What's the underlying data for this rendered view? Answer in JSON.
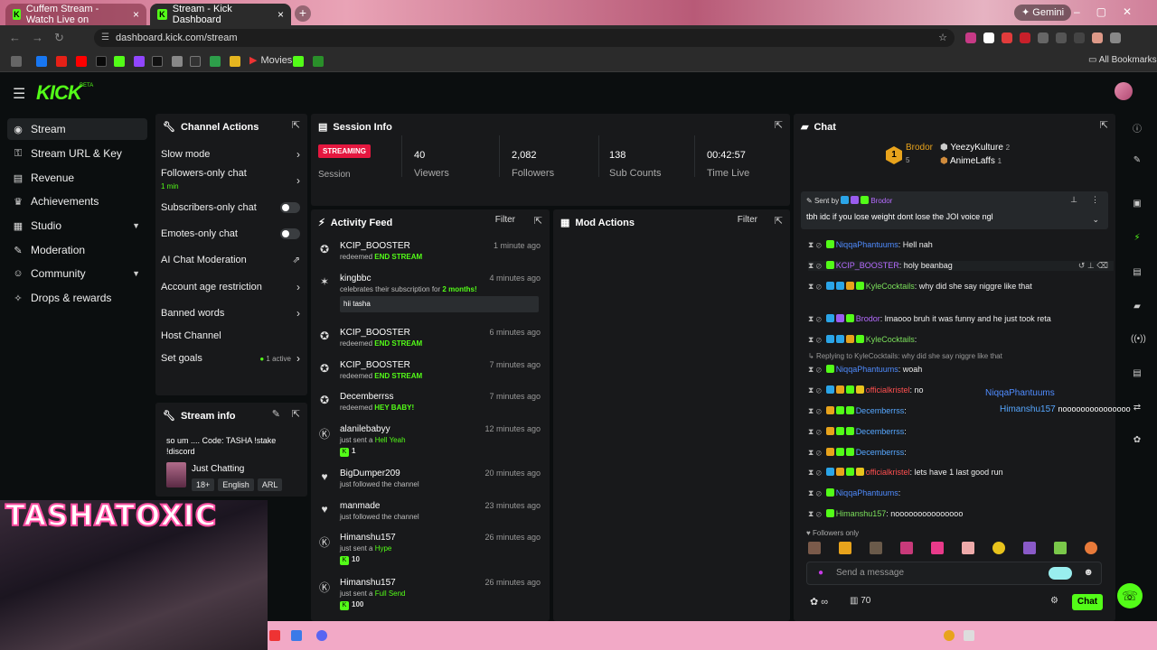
{
  "browser": {
    "tabs": [
      {
        "title": "Cuffem Stream - Watch Live on"
      },
      {
        "title": "Stream - Kick Dashboard"
      }
    ],
    "gemini": "Gemini",
    "url": "dashboard.kick.com/stream",
    "bookmark_movies": "Movies",
    "all_bookmarks": "All Bookmarks"
  },
  "app": {
    "logo": "KICK",
    "beta": "BETA"
  },
  "sidebar": {
    "items": [
      {
        "label": "Stream",
        "icon": "wifi-icon"
      },
      {
        "label": "Stream URL & Key",
        "icon": "key-icon"
      },
      {
        "label": "Revenue",
        "icon": "dollar-icon"
      },
      {
        "label": "Achievements",
        "icon": "trophy-icon"
      },
      {
        "label": "Studio",
        "icon": "grid-icon"
      },
      {
        "label": "Moderation",
        "icon": "wrench-icon"
      },
      {
        "label": "Community",
        "icon": "users-icon"
      },
      {
        "label": "Drops & rewards",
        "icon": "gift-icon"
      }
    ]
  },
  "channel_actions": {
    "title": "Channel Actions",
    "slow_mode": "Slow mode",
    "followers_only": "Followers-only chat",
    "followers_sub": "1 min",
    "subscribers_only": "Subscribers-only chat",
    "emotes_only": "Emotes-only chat",
    "ai_moderation": "AI Chat Moderation",
    "age_restriction": "Account age restriction",
    "banned_words": "Banned words",
    "host": "Host Channel",
    "goals": "Set goals",
    "goals_active": "1 active"
  },
  "stream_info": {
    "title": "Stream info",
    "text": "so um .... Code: TASHA !stake !discord",
    "category": "Just Chatting",
    "tags": [
      "18+",
      "English",
      "ARL"
    ]
  },
  "session": {
    "title": "Session Info",
    "status": "STREAMING",
    "session_label": "Session",
    "viewers": "40",
    "viewers_label": "Viewers",
    "followers": "2,082",
    "followers_label": "Followers",
    "subs": "138",
    "subs_label": "Sub Counts",
    "time": "00:42:57",
    "time_label": "Time Live"
  },
  "activity": {
    "title": "Activity Feed",
    "filter": "Filter",
    "items": [
      {
        "name": "KCIP_BOOSTER",
        "time": "1 minute ago",
        "desc": "redeemed",
        "hl": "END STREAM"
      },
      {
        "name": "kingbbc",
        "time": "4 minutes ago",
        "desc": "celebrates their subscription for",
        "hl": "2 months!",
        "quote": "hii tasha"
      },
      {
        "name": "KCIP_BOOSTER",
        "time": "6 minutes ago",
        "desc": "redeemed",
        "hl": "END STREAM"
      },
      {
        "name": "KCIP_BOOSTER",
        "time": "7 minutes ago",
        "desc": "redeemed",
        "hl": "END STREAM"
      },
      {
        "name": "Decemberrss",
        "time": "7 minutes ago",
        "desc": "redeemed",
        "hl": "HEY BABY!"
      },
      {
        "name": "alanilebabyy",
        "time": "12 minutes ago",
        "desc": "just sent a",
        "hl": "Hell Yeah",
        "amount": "1"
      },
      {
        "name": "BigDumper209",
        "time": "20 minutes ago",
        "desc": "just followed the channel"
      },
      {
        "name": "manmade",
        "time": "23 minutes ago",
        "desc": "just followed the channel"
      },
      {
        "name": "Himanshu157",
        "time": "26 minutes ago",
        "desc": "just sent a",
        "hl": "Hype",
        "amount": "10"
      },
      {
        "name": "Himanshu157",
        "time": "26 minutes ago",
        "desc": "just sent a",
        "hl": "Full Send",
        "amount": "100"
      }
    ]
  },
  "mod_actions": {
    "title": "Mod Actions",
    "filter": "Filter"
  },
  "chat": {
    "title": "Chat",
    "leaders": [
      {
        "rank": "1",
        "name": "Brodor",
        "count": "5"
      },
      {
        "name": "YeezyKulture",
        "count": "2"
      },
      {
        "name": "AnimeLaffs",
        "count": "1"
      }
    ],
    "pinned_by": "Sent by",
    "pinned_user": "Brodor",
    "pinned_text": "tbh idc if you lose weight dont lose the JOI voice ngl",
    "messages": [
      {
        "user": "NiqqaPhantuums",
        "text": ": Hell nah"
      },
      {
        "user": "KCIP_BOOSTER",
        "text": ": holy beanbag"
      },
      {
        "user": "KyleCocktails",
        "text": ": why did she say niggre like that"
      },
      {
        "user": "Brodor",
        "text": ": lmaooo bruh it was funny and he just took reta"
      },
      {
        "user": "KyleCocktails",
        "text": ":"
      },
      {
        "reply": "Replying to KyleCocktails: why did she say niggre like that"
      },
      {
        "user": "NiqqaPhantuums",
        "text": ": woah"
      },
      {
        "user": "officialkristel",
        "text": ": no"
      },
      {
        "user": "Decemberrss",
        "text": ":"
      },
      {
        "user": "Decemberrss",
        "text": ":"
      },
      {
        "user": "Decemberrss",
        "text": ":"
      },
      {
        "user": "officialkristel",
        "text": ": lets have 1 last good run"
      },
      {
        "user": "NiqqaPhantuums",
        "text": ":"
      },
      {
        "user": "Himanshu157",
        "text": ": nooooooooooooooo"
      }
    ],
    "overlay_user1": "NiqqaPhantuums",
    "overlay_user2": "Himanshu157",
    "overlay_text2": "nooooooooooooooo",
    "followers_only": "Followers only",
    "placeholder": "Send a message",
    "viewer_count": "70",
    "send": "Chat"
  },
  "webcam": {
    "overlay_name": "TASHATOXIC"
  }
}
